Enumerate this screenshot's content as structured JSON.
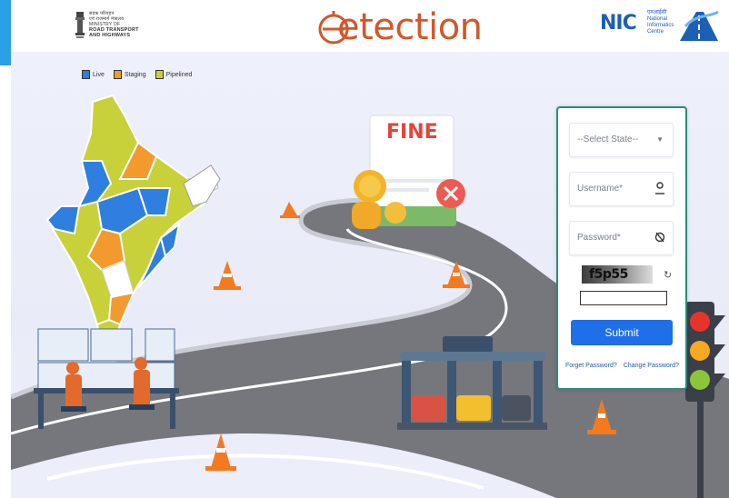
{
  "header": {
    "ministry_logo": {
      "hindi_line1": "सड़क परिवहन",
      "hindi_line2": "एवं राजमार्ग मंत्रालय",
      "line1": "MINISTRY OF",
      "line2": "ROAD TRANSPORT",
      "line3": "AND HIGHWAYS"
    },
    "brand": {
      "text": "etection"
    },
    "nic_logo": {
      "mark": "NIC",
      "hindi": "एनआईसी",
      "line1": "National",
      "line2": "Informatics",
      "line3": "Centre"
    }
  },
  "legend": {
    "items": [
      {
        "label": "Live",
        "color": "#2e7fe0"
      },
      {
        "label": "Staging",
        "color": "#f29a2e"
      },
      {
        "label": "Pipelined",
        "color": "#c8d13a"
      }
    ]
  },
  "illustrations": {
    "fine_sign": "FINE"
  },
  "login": {
    "state_select": "--Select State--",
    "username_placeholder": "Username*",
    "password_placeholder": "Password*",
    "captcha_text": "f5p55",
    "submit_label": "Submit",
    "forgot_password": "Forget Password?",
    "change_password": "Change Password?"
  },
  "colors": {
    "accent": "#1e6fe8",
    "brand": "#d2572a",
    "panel_border": "#2b8c79",
    "road": "#75777d"
  }
}
